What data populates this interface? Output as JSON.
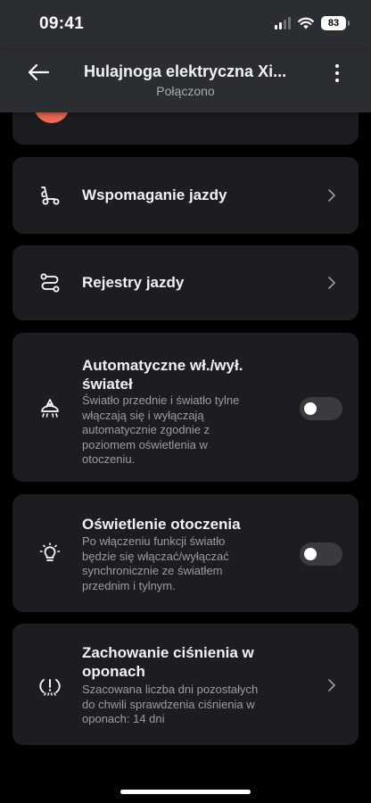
{
  "status_bar": {
    "time": "09:41",
    "battery": "83"
  },
  "header": {
    "title": "Hulajnoga elektryczna Xi...",
    "subtitle": "Połączono"
  },
  "items": [
    {
      "title": "Wspomaganie jazdy",
      "icon": "scooter-icon"
    },
    {
      "title": "Rejestry jazdy",
      "icon": "route-icon"
    },
    {
      "title_line1": "Automatyczne wł./wył.",
      "title_line2": "świateł",
      "desc": [
        "Światło przednie i światło tylne",
        "włączają się i wyłączają",
        "automatycznie zgodnie z",
        "poziomem oświetlenia w",
        "otoczeniu."
      ],
      "icon": "auto-light-icon",
      "toggle_on": false
    },
    {
      "title": "Oświetlenie otoczenia",
      "desc": [
        "Po włączeniu funkcji światło",
        "będzie się włączać/wyłączać",
        "synchronicznie ze światłem",
        "przednim i tylnym."
      ],
      "icon": "bulb-icon",
      "toggle_on": false
    },
    {
      "title_line1": "Zachowanie ciśnienia w",
      "title_line2": "oponach",
      "desc": [
        "Szacowana liczba dni pozostałych",
        "do chwili sprawdzenia ciśnienia w",
        "oponach: 14 dni"
      ],
      "icon": "tire-pressure-icon"
    }
  ],
  "colors": {
    "background": "#000000",
    "card": "#1c1d20",
    "header": "#2a2d31",
    "accent_partial": "#ee6a50",
    "toggle_off": "#3a3b3f"
  }
}
